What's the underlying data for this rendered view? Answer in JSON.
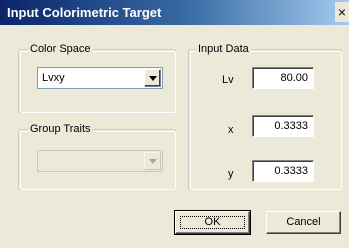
{
  "window": {
    "title": "Input Colorimetric Target",
    "close_glyph": "×"
  },
  "color_space": {
    "legend": "Color Space",
    "selected": "Lvxy"
  },
  "group_traits": {
    "legend": "Group Traits",
    "selected": ""
  },
  "input_data": {
    "legend": "Input Data",
    "fields": [
      {
        "label": "Lv",
        "value": "80.00"
      },
      {
        "label": "x",
        "value": "0.3333"
      },
      {
        "label": "y",
        "value": "0.3333"
      }
    ]
  },
  "buttons": {
    "ok": "OK",
    "cancel": "Cancel"
  },
  "icons": {
    "dropdown": "chevron-down-icon",
    "close": "close-icon"
  }
}
